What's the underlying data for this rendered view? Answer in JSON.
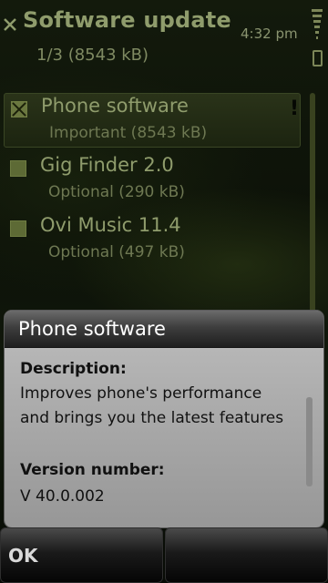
{
  "status": {
    "time": "4:32 pm",
    "icons": [
      "signal-bars-icon",
      "battery-icon"
    ]
  },
  "header": {
    "title": "Software update",
    "subtitle": "1/3 (8543 kB)",
    "close_icon": "close-icon"
  },
  "updates": [
    {
      "title": "Phone software",
      "detail": "Important (8543 kB)",
      "checked": true,
      "important_marker": "!"
    },
    {
      "title": "Gig Finder 2.0",
      "detail": "Optional (290 kB)",
      "checked": false
    },
    {
      "title": "Ovi Music 11.4",
      "detail": "Optional (497 kB)",
      "checked": false
    }
  ],
  "dialog": {
    "title": "Phone software",
    "description_label": "Description:",
    "description_line1": "Improves phone's performance",
    "description_line2": "and brings you the latest features",
    "version_label": "Version number:",
    "version_value": "V 40.0.002"
  },
  "softkeys": {
    "left_label": "OK",
    "right_label": ""
  },
  "colors": {
    "accent": "#8f9c6c",
    "background": "#0c1108",
    "dialog_bg": "#b0b0b0"
  }
}
